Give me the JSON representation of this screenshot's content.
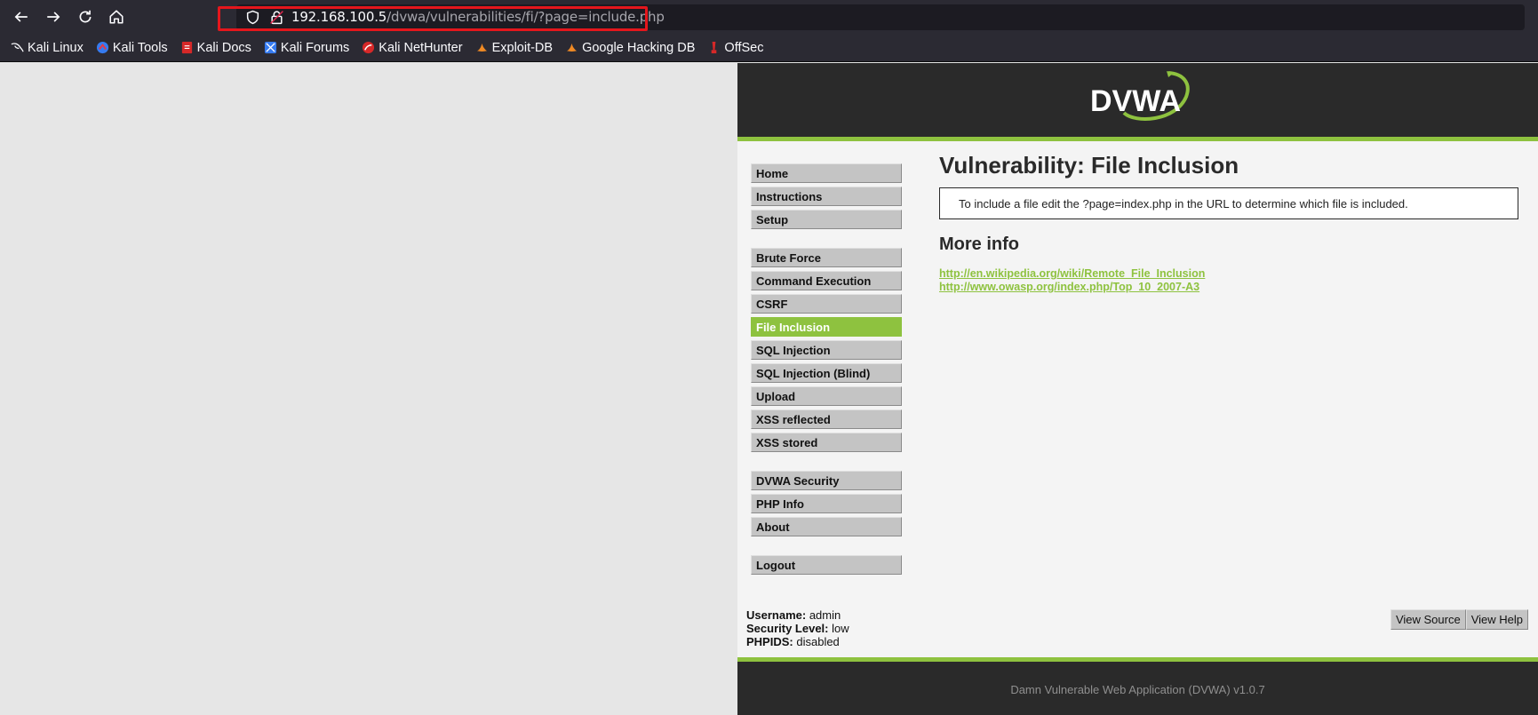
{
  "browser": {
    "url_host": "192.168.100.5",
    "url_path": "/dvwa/vulnerabilities/fi/?page=include.php",
    "bookmarks": [
      {
        "label": "Kali Linux",
        "icon": "kali-dragon-icon"
      },
      {
        "label": "Kali Tools",
        "icon": "kali-tools-icon"
      },
      {
        "label": "Kali Docs",
        "icon": "kali-docs-icon"
      },
      {
        "label": "Kali Forums",
        "icon": "kali-forums-icon"
      },
      {
        "label": "Kali NetHunter",
        "icon": "nethunter-icon"
      },
      {
        "label": "Exploit-DB",
        "icon": "exploit-db-icon"
      },
      {
        "label": "Google Hacking DB",
        "icon": "ghdb-icon"
      },
      {
        "label": "OffSec",
        "icon": "offsec-icon"
      }
    ]
  },
  "dvwa": {
    "logo_text": "DVWA",
    "menu": {
      "group1": [
        "Home",
        "Instructions",
        "Setup"
      ],
      "group2": [
        "Brute Force",
        "Command Execution",
        "CSRF",
        "File Inclusion",
        "SQL Injection",
        "SQL Injection (Blind)",
        "Upload",
        "XSS reflected",
        "XSS stored"
      ],
      "group3": [
        "DVWA Security",
        "PHP Info",
        "About"
      ],
      "group4": [
        "Logout"
      ],
      "active": "File Inclusion"
    },
    "title": "Vulnerability: File Inclusion",
    "info_text": "To include a file edit the ?page=index.php in the URL to determine which file is included.",
    "more_info_heading": "More info",
    "links": [
      "http://en.wikipedia.org/wiki/Remote_File_Inclusion",
      "http://www.owasp.org/index.php/Top_10_2007-A3"
    ],
    "user": {
      "username_label": "Username:",
      "username": "admin",
      "security_label": "Security Level:",
      "security": "low",
      "phpids_label": "PHPIDS:",
      "phpids": "disabled"
    },
    "buttons": {
      "view_source": "View Source",
      "view_help": "View Help"
    },
    "footer": "Damn Vulnerable Web Application (DVWA) v1.0.7"
  },
  "colors": {
    "accent": "#8ec23f",
    "dark": "#2a2a2a",
    "highlight": "#e5161c"
  }
}
